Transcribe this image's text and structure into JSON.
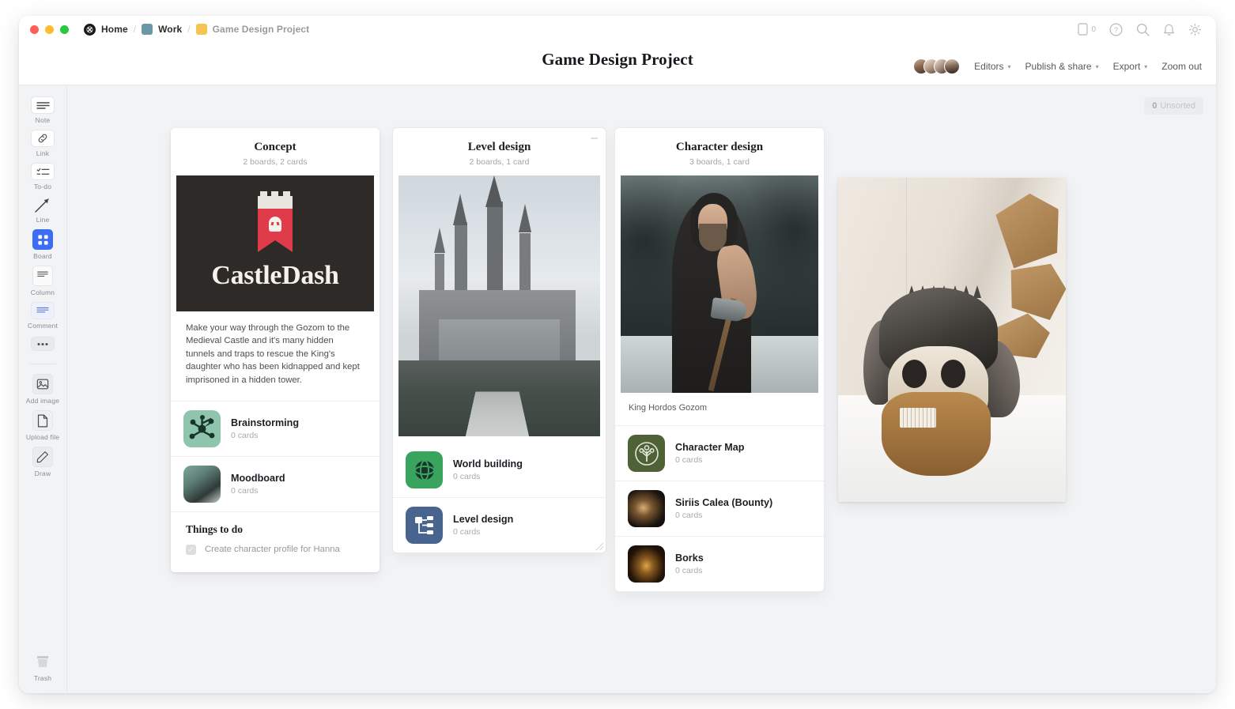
{
  "window": {
    "traffic_lights": [
      "close",
      "minimize",
      "maximize"
    ]
  },
  "breadcrumb": {
    "home_label": "Home",
    "workspace_label": "Work",
    "workspace_color": "#6b97a8",
    "project_label": "Game Design Project",
    "project_color": "#f5c452",
    "separator": "/"
  },
  "titlebar_icons": [
    {
      "name": "mobile-icon",
      "glyph": "mobile",
      "count": "0"
    },
    {
      "name": "help-icon",
      "glyph": "?"
    },
    {
      "name": "search-icon",
      "glyph": "search"
    },
    {
      "name": "notifications-icon",
      "glyph": "bell"
    },
    {
      "name": "settings-icon",
      "glyph": "gear"
    }
  ],
  "header": {
    "title": "Game Design Project",
    "editors_label": "Editors",
    "publish_label": "Publish & share",
    "export_label": "Export",
    "zoom_out_label": "Zoom out",
    "caret": "▾",
    "avatar_count": 4
  },
  "toolbar": {
    "items": [
      {
        "label": "Note",
        "icon": "note-icon",
        "active": false
      },
      {
        "label": "Link",
        "icon": "link-icon",
        "active": false
      },
      {
        "label": "To-do",
        "icon": "todo-icon",
        "active": false
      },
      {
        "label": "Line",
        "icon": "line-icon",
        "active": false
      },
      {
        "label": "Board",
        "icon": "board-icon",
        "active": true
      },
      {
        "label": "Column",
        "icon": "column-icon",
        "active": false
      },
      {
        "label": "Comment",
        "icon": "comment-icon",
        "active": false
      }
    ],
    "more_label": "•••",
    "media": [
      {
        "label": "Add image",
        "icon": "image-icon"
      },
      {
        "label": "Upload file",
        "icon": "file-icon"
      },
      {
        "label": "Draw",
        "icon": "pencil-icon"
      }
    ],
    "trash": {
      "label": "Trash",
      "icon": "trash-icon"
    },
    "active_color": "#3b6df5"
  },
  "canvas": {
    "unsorted_count": "0",
    "unsorted_label": "Unsorted"
  },
  "boards": [
    {
      "id": "concept",
      "title": "Concept",
      "subtitle": "2 boards, 2 cards",
      "hero": {
        "type": "logo",
        "wordmark": "CastleDash",
        "bg": "#2e2a27",
        "accent": "#e03b4a"
      },
      "description": "Make your way through the Gozom to the Medieval Castle and it's many hidden tunnels and traps to rescue the King's daughter who has been kidnapped and kept imprisoned in a hidden tower.",
      "items": [
        {
          "name": "Brainstorming",
          "count": "0 cards",
          "thumb": "brainstorm-thumb"
        },
        {
          "name": "Moodboard",
          "count": "0 cards",
          "thumb": "moodboard-thumb"
        }
      ],
      "todo": {
        "title": "Things to do",
        "tasks": [
          {
            "text": "Create character profile for Hanna",
            "done": true
          }
        ]
      }
    },
    {
      "id": "level-design",
      "title": "Level design",
      "subtitle": "2 boards, 1 card",
      "hero": {
        "type": "photo",
        "subject": "medieval-castle-photo"
      },
      "items": [
        {
          "name": "World building",
          "count": "0 cards",
          "thumb": "world-thumb"
        },
        {
          "name": "Level design",
          "count": "0 cards",
          "thumb": "level-thumb"
        }
      ]
    },
    {
      "id": "character-design",
      "title": "Character design",
      "subtitle": "3 boards, 1 card",
      "hero": {
        "type": "photo",
        "subject": "warrior-with-axe-photo"
      },
      "caption": "King Hordos Gozom",
      "items": [
        {
          "name": "Character Map",
          "count": "0 cards",
          "thumb": "charmap-thumb"
        },
        {
          "name": "Siriis Calea (Bounty)",
          "count": "0 cards",
          "thumb": "siriis-thumb"
        },
        {
          "name": "Borks",
          "count": "0 cards",
          "thumb": "borks-thumb"
        }
      ]
    }
  ],
  "floating_image": {
    "name": "viking-skull-sculpture-image"
  },
  "colors": {
    "canvas_bg": "#f2f3f5",
    "card_bg": "#ffffff",
    "accent": "#3b6df5",
    "text_primary": "#1b1d21",
    "text_muted": "#a4a5aa"
  }
}
